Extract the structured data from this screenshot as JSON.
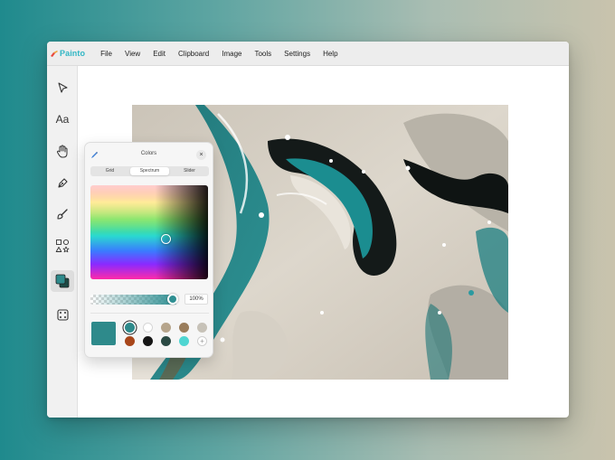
{
  "app": {
    "name": "Painto",
    "brand_color": "#31b6c4"
  },
  "menu": {
    "items": [
      "File",
      "View",
      "Edit",
      "Clipboard",
      "Image",
      "Tools",
      "Settings",
      "Help"
    ]
  },
  "toolbar": {
    "tools": [
      {
        "name": "select",
        "icon": "pointer-icon"
      },
      {
        "name": "text",
        "icon": "text-icon",
        "label": "Aa"
      },
      {
        "name": "pan",
        "icon": "hand-icon"
      },
      {
        "name": "pen",
        "icon": "pen-icon"
      },
      {
        "name": "brush",
        "icon": "brush-icon"
      },
      {
        "name": "shapes",
        "icon": "shapes-icon"
      },
      {
        "name": "colors",
        "icon": "color-swatch-icon",
        "active": true
      },
      {
        "name": "dice",
        "icon": "dice-icon"
      }
    ]
  },
  "color_panel": {
    "title": "Colors",
    "close_label": "×",
    "tabs": [
      "Grid",
      "Spectrum",
      "Slider"
    ],
    "active_tab": "Spectrum",
    "opacity": "100%",
    "opacity_value": 1.0,
    "current_color": "#2e8a8b",
    "swatches": [
      {
        "color": "#2e8a8b",
        "selected": true
      },
      {
        "color": "#ffffff"
      },
      {
        "color": "#b6a58c"
      },
      {
        "color": "#9a7d5c"
      },
      {
        "color": "#c7c2b8"
      },
      {
        "color": "#a8461a"
      },
      {
        "color": "#161616"
      },
      {
        "color": "#2b4a44"
      },
      {
        "color": "#4fd6d2"
      }
    ],
    "add_label": "+"
  }
}
